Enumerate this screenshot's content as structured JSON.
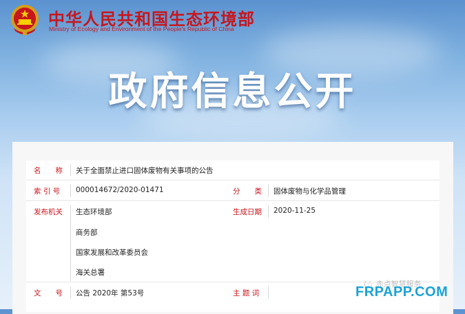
{
  "header": {
    "ministry_cn": "中华人民共和国生态环境部",
    "ministry_en": "Ministry of Ecology and Environment of the People's Republic of China",
    "banner_title": "政府信息公开"
  },
  "info": {
    "name_label": "名　　称",
    "name_value": "关于全面禁止进口固体废物有关事项的公告",
    "index_label": "索 引 号",
    "index_value": "000014672/2020-01471",
    "category_label": "分　　类",
    "category_value": "固体废物与化学品管理",
    "issuer_label": "发布机关",
    "issuers": [
      "生态环境部",
      "商务部",
      "国家发展和改革委员会",
      "海关总署"
    ],
    "date_label": "生成日期",
    "date_value": "2020-11-25",
    "docno_label": "文　　号",
    "docno_value": "公告 2020年 第53号",
    "subject_label": "主 题 词",
    "subject_value": ""
  },
  "watermark": {
    "text": "FRPAPP.COM",
    "ghost": "(☆ 赤点智慧服务"
  },
  "colors": {
    "accent": "#c8161d",
    "watermark": "#1aa3d6"
  },
  "icons": {
    "emblem": "national-emblem-icon"
  }
}
